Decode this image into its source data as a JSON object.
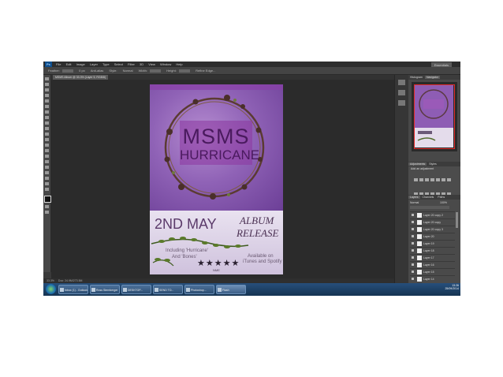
{
  "app": {
    "menus": [
      "File",
      "Edit",
      "Image",
      "Layer",
      "Type",
      "Select",
      "Filter",
      "3D",
      "View",
      "Window",
      "Help"
    ],
    "workspace": "Essentials"
  },
  "options_bar": {
    "items": [
      "Feather:",
      "0 px",
      "Anti-alias",
      "Style:",
      "Normal",
      "Width:",
      "Height:",
      "Refine Edge..."
    ]
  },
  "document": {
    "tab": "MSMS Album @ 33.3% (Layer 5, RGB/8)",
    "zoom": "33.3%",
    "doc_size": "Doc: 24.9M/273.5M"
  },
  "panels": {
    "tabs": [
      "Histogram",
      "Navigator"
    ],
    "adjustments": {
      "tabs": [
        "Adjustments",
        "Styles"
      ],
      "subtitle": "Add an adjustment"
    },
    "layers": {
      "tabs": [
        "Layers",
        "Channels",
        "Paths"
      ],
      "blend_mode": "Normal",
      "opacity": "100%",
      "items": [
        "Layer 20 copy 2",
        "Layer 20 copy",
        "Layer 20 copy 3",
        "Layer 20",
        "Layer 19",
        "Layer 18",
        "Layer 17",
        "Layer 16",
        "Layer 15",
        "Layer 14"
      ]
    }
  },
  "taskbar": {
    "buttons": [
      "Inbox (1) - Outlook",
      "Ross Sternberger",
      "DESKTOP...",
      "SEND TO...",
      "Photoshop...",
      "Flash"
    ],
    "time": "13:26",
    "date": "25/09/2014"
  },
  "poster": {
    "title_line1": "MSMS",
    "title_line2": "HURRICANE",
    "date": "2ND MAY",
    "album_line1": "ALBUM",
    "album_line2": "RELEASE",
    "including_line1": "Including 'Hurricane'",
    "including_line2": "And 'Bones'",
    "available_line1": "Available on",
    "available_line2": "iTunes and Spotify",
    "stars": "★★★★★",
    "rating_source": "NME",
    "accent_color": "#8f62b6"
  }
}
